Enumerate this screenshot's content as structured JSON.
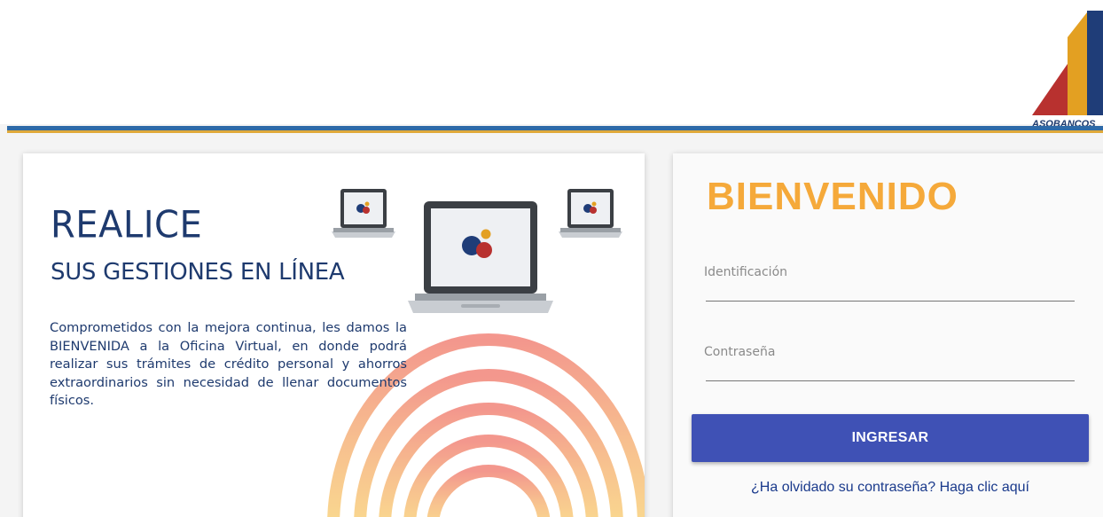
{
  "header": {
    "logo_text": "ASOBANCOS",
    "colors": {
      "blue_stripe": "#2e6aa8",
      "gold_stripe": "#e0a93a"
    }
  },
  "promo": {
    "headline": "REALICE",
    "subheadline": "SUS GESTIONES EN LÍNEA",
    "body": "Comprometidos con la mejora continua, les damos la BIENVENIDA a la Oficina Virtual, en donde podrá realizar sus trámites de crédito personal y ahorros extraordinarios sin necesidad de llenar documentos físicos.",
    "icons": [
      "laptop-icon",
      "laptop-icon",
      "laptop-icon"
    ]
  },
  "login": {
    "title": "BIENVENIDO",
    "id_label": "Identificación",
    "id_value": "",
    "password_label": "Contraseña",
    "password_value": "",
    "submit_label": "INGRESAR",
    "forgot_link": "¿Ha olvidado su contraseña? Haga clic aquí",
    "colors": {
      "title": "#f5a93a",
      "button": "#3f51b5",
      "link": "#1a3a8c"
    }
  }
}
